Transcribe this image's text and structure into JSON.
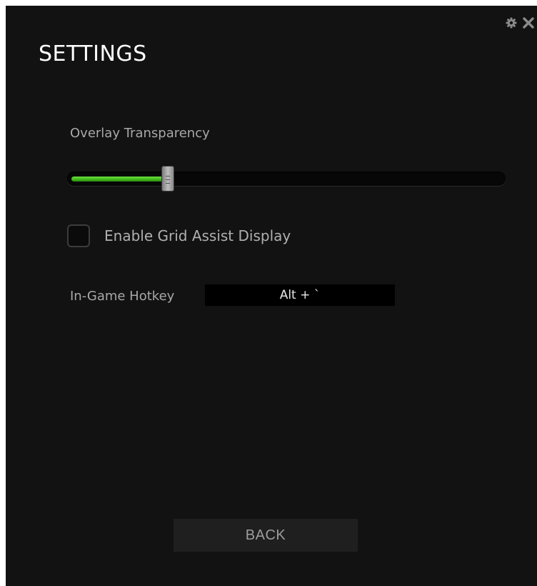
{
  "window": {
    "title": "SETTINGS",
    "controls": [
      {
        "icon": "gear-icon"
      },
      {
        "icon": "close-icon"
      }
    ]
  },
  "overlay_transparency": {
    "label": "Overlay Transparency",
    "value_fraction": 0.23
  },
  "grid_assist": {
    "label": "Enable Grid Assist Display",
    "checked": false
  },
  "hotkey": {
    "label": "In-Game Hotkey",
    "value": "Alt + `"
  },
  "back_button": {
    "label": "BACK"
  },
  "colors": {
    "background": "#121212",
    "accent_green": "#44c01a",
    "title_text": "#ffffff",
    "label_text": "#a8a8a8"
  }
}
